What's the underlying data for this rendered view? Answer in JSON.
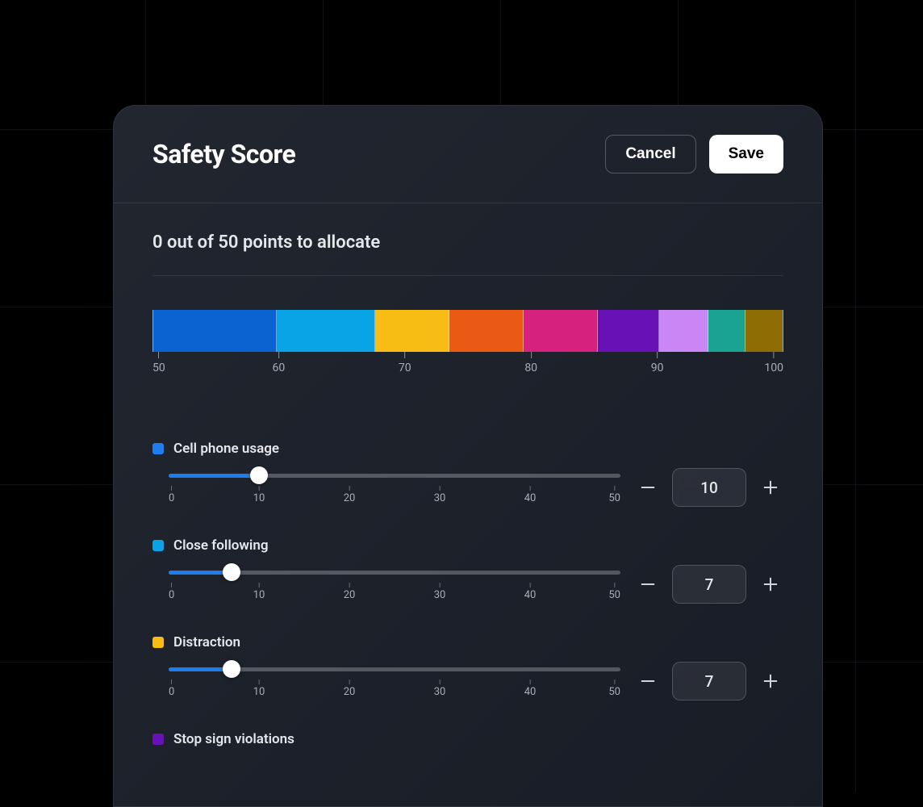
{
  "header": {
    "title": "Safety Score",
    "cancel_label": "Cancel",
    "save_label": "Save"
  },
  "allocation": {
    "text": "0 out of 50 points to allocate"
  },
  "color_bar": {
    "min": 50,
    "max": 100,
    "ticks": [
      "50",
      "60",
      "70",
      "80",
      "90",
      "100"
    ],
    "segments": [
      {
        "color": "#0a63d0",
        "weight": 10
      },
      {
        "color": "#08a4e5",
        "weight": 8
      },
      {
        "color": "#f8bd14",
        "weight": 6
      },
      {
        "color": "#ea5a14",
        "weight": 6
      },
      {
        "color": "#d6227e",
        "weight": 6
      },
      {
        "color": "#6711b7",
        "weight": 5
      },
      {
        "color": "#c986f4",
        "weight": 4
      },
      {
        "color": "#1aa393",
        "weight": 3
      },
      {
        "color": "#8e6d04",
        "weight": 3
      }
    ]
  },
  "slider_scale": {
    "min": 0,
    "max": 50,
    "ticks": [
      "0",
      "10",
      "20",
      "30",
      "40",
      "50"
    ]
  },
  "categories": [
    {
      "name": "Cell phone usage",
      "color": "#1f7df0",
      "value": 10
    },
    {
      "name": "Close following",
      "color": "#08a4e5",
      "value": 7
    },
    {
      "name": "Distraction",
      "color": "#f8bd14",
      "value": 7
    },
    {
      "name": "Stop sign violations",
      "color": "#6711b7",
      "value": null
    }
  ]
}
